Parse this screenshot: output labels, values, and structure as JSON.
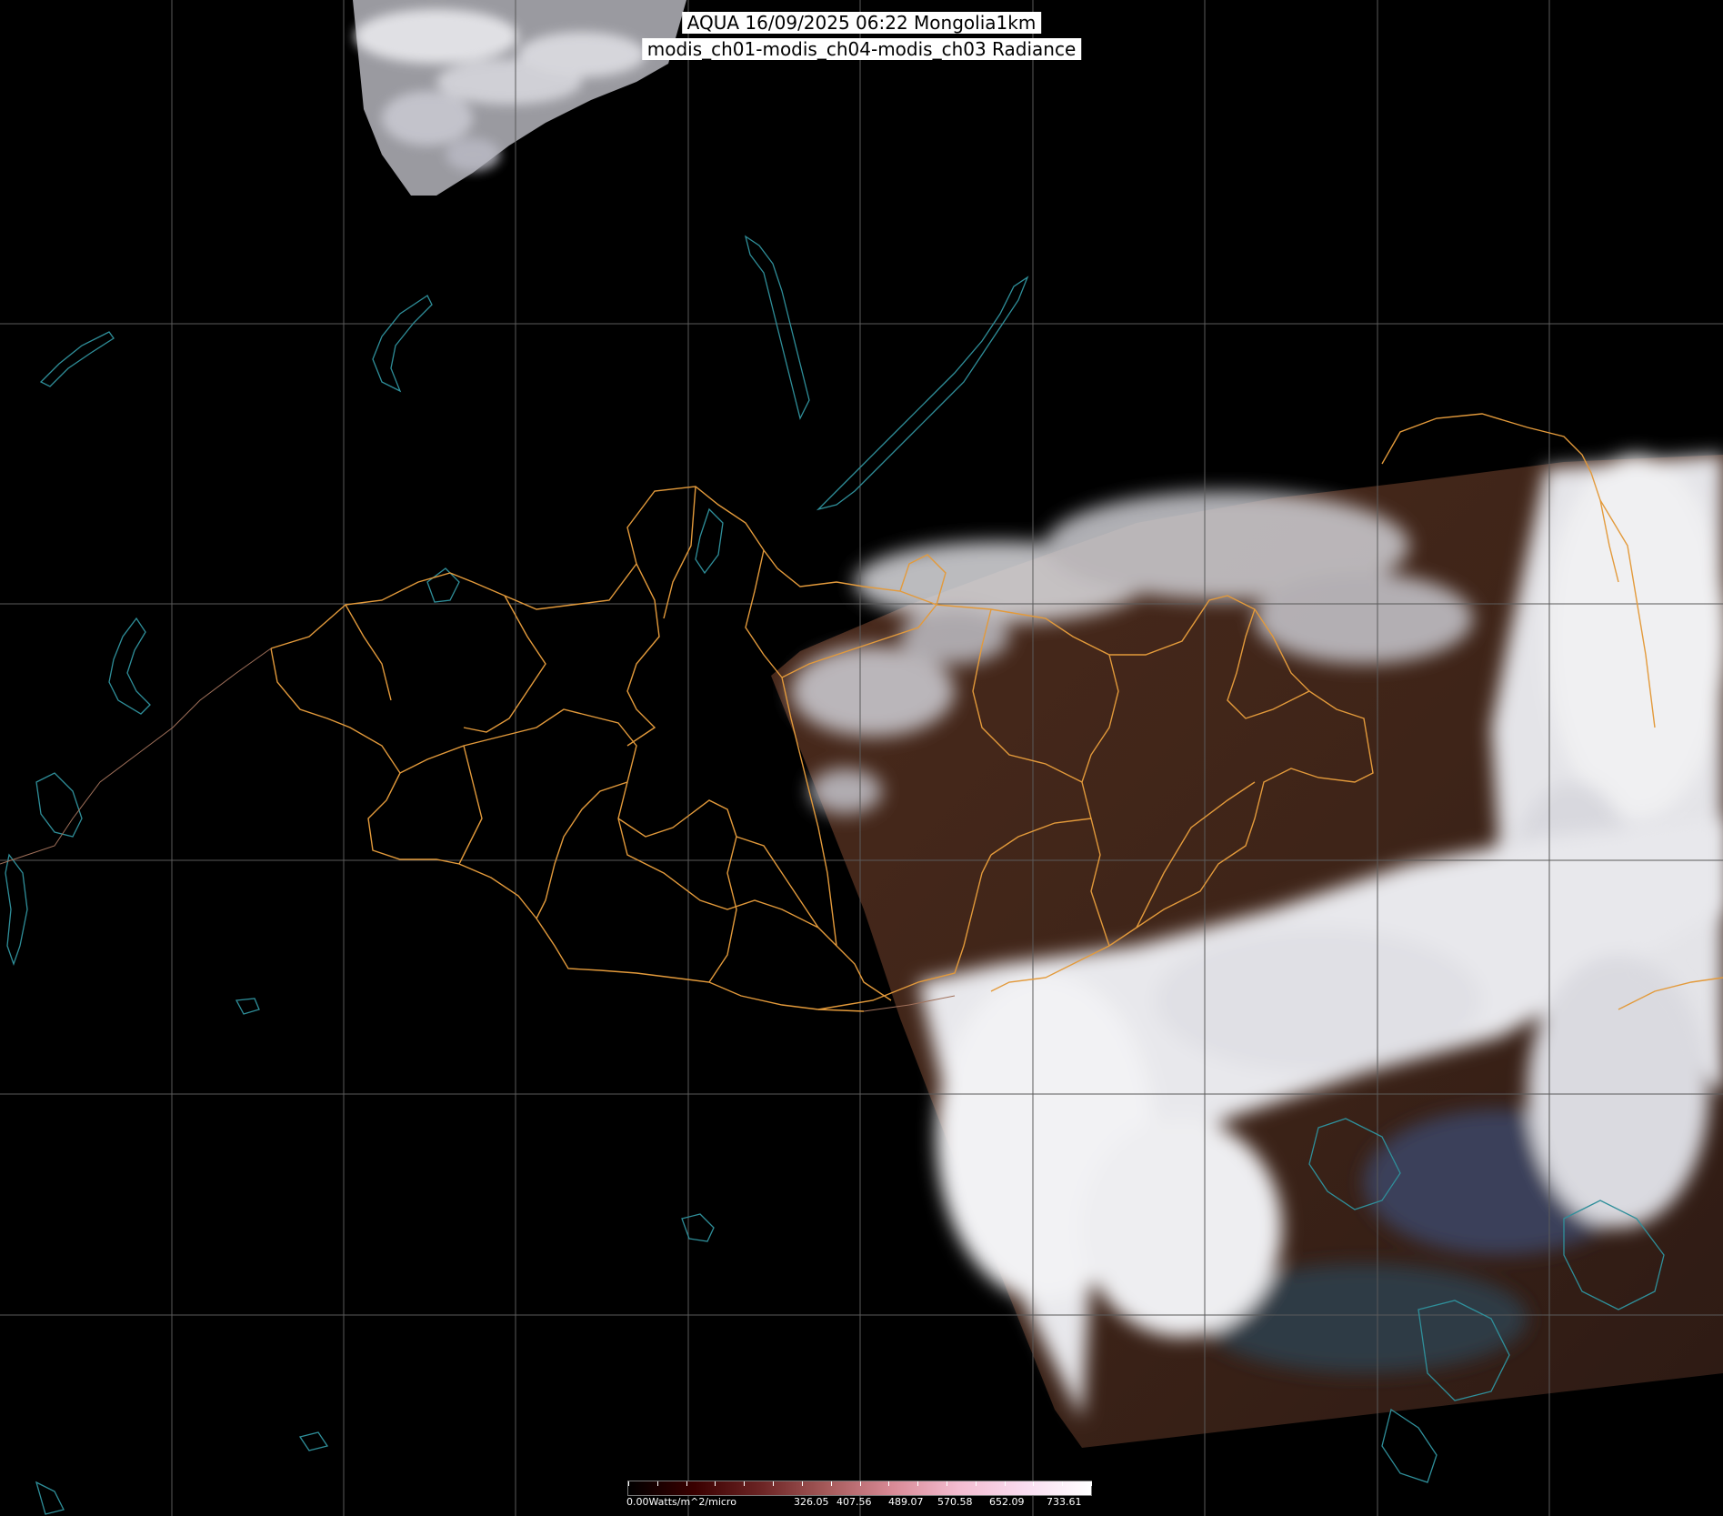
{
  "header": {
    "title_line1": "AQUA 16/09/2025 06:22 Mongolia1km",
    "title_line2": "modis_ch01-modis_ch04-modis_ch03 Radiance"
  },
  "colorbar": {
    "labels": [
      "0.00Watts/m^2/micro",
      "326.05",
      "407.56",
      "489.07",
      "570.58",
      "652.09",
      "733.61"
    ],
    "stops": [
      "#000000",
      "#3a0000",
      "#6b2424",
      "#a55a5a",
      "#d88a96",
      "#f3bcd0",
      "#f9dcf0",
      "#ffffff"
    ]
  },
  "colors": {
    "background": "#000000",
    "grid": "#666666",
    "province_borders": "#e39a3b",
    "coastline": "#2f8f9a",
    "land_dark": "#3e2418",
    "cloud": "#e6e6ea"
  }
}
